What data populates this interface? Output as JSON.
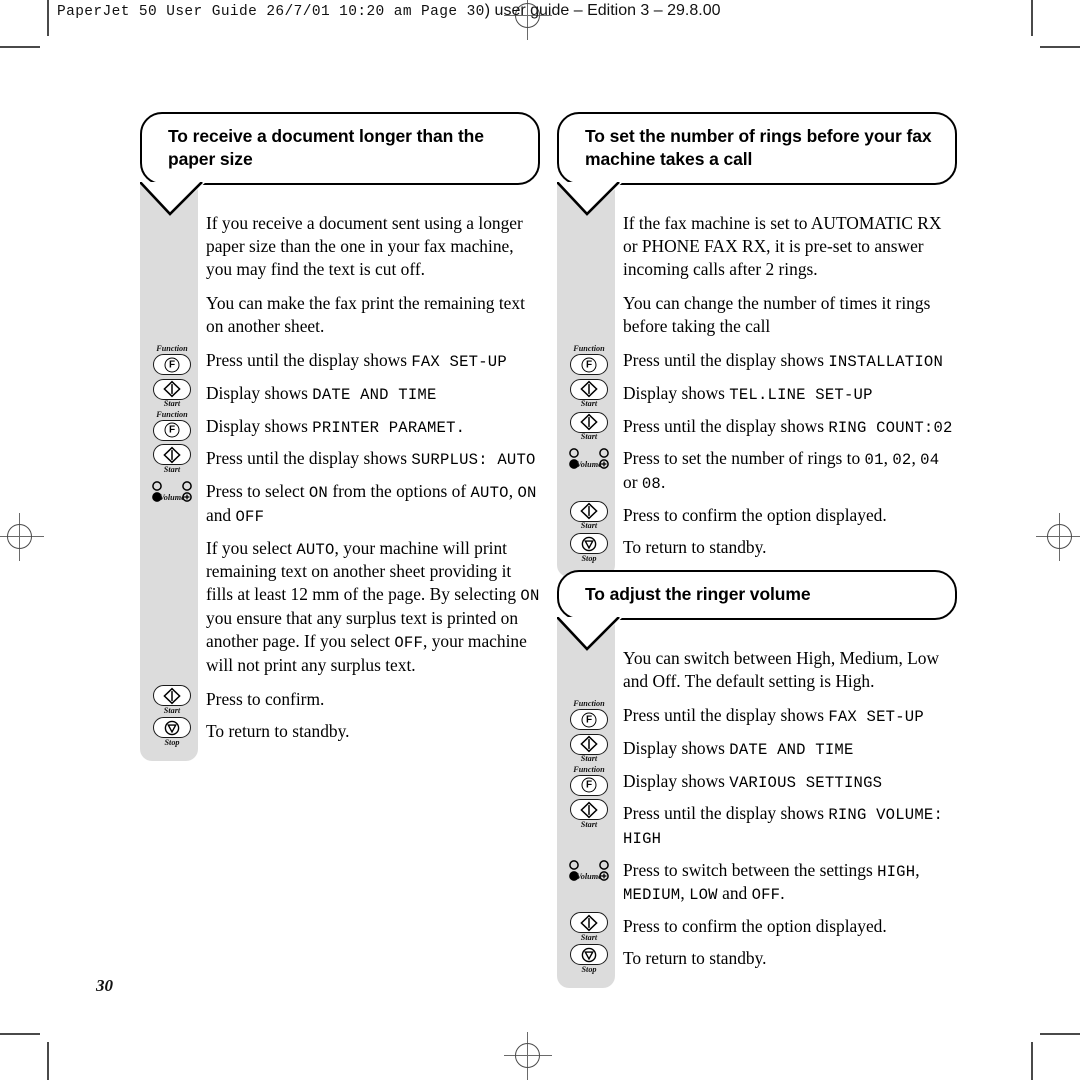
{
  "page": {
    "running_head_mono": "PaperJet 50 User Guide  26/7/01  10:20 am  Page 30",
    "running_head_sans": ") user guide – Edition 3 – 29.8.00",
    "folio": "30"
  },
  "controls": {
    "function": {
      "caption": "Function",
      "key": "F"
    },
    "start": {
      "caption": "Start"
    },
    "stop": {
      "caption": "Stop"
    },
    "volume": {
      "caption": "Volume"
    }
  },
  "sections": [
    {
      "id": "receive-longer-document",
      "heading": "To receive a document longer than the paper size",
      "rows": [
        {
          "control": "none",
          "html": "If you receive a document sent using a longer paper size than the one in your fax machine, you may find the text is cut off."
        },
        {
          "control": "none",
          "html": "You can make the fax print the remaining text on another sheet."
        },
        {
          "control": "function",
          "html": "Press until the display shows <code>FAX SET-UP</code>"
        },
        {
          "control": "start",
          "html": "Display shows <code>DATE AND TIME</code>"
        },
        {
          "control": "function",
          "html": "Display shows <code>PRINTER PARAMET.</code>"
        },
        {
          "control": "start",
          "html": "Press until the display shows <code>SURPLUS: AUTO</code>"
        },
        {
          "control": "volume",
          "html": "Press to select <code>ON</code> from the options of <code>AUTO</code>, <code>ON</code> and <code>OFF</code>"
        },
        {
          "control": "none",
          "html": "If you select <code>AUTO</code>, your machine will print remaining text on another sheet providing it fills at least 12 mm of the page. By selecting <code>ON</code> you ensure that any surplus text is printed on another page. If you select <code>OFF</code>, your machine will not print any surplus text."
        },
        {
          "control": "start",
          "html": "Press to confirm."
        },
        {
          "control": "stop",
          "html": "To return to standby."
        }
      ]
    },
    {
      "id": "number-of-rings",
      "heading": "To set the number of rings before your fax machine takes a call",
      "rows": [
        {
          "control": "none",
          "html": "If the fax machine is set to AUTOMATIC RX or PHONE FAX RX, it is pre-set to answer incoming calls after 2 rings."
        },
        {
          "control": "none",
          "html": "You can change the number of times it rings before taking the call"
        },
        {
          "control": "function",
          "html": "Press until the display shows <code>INSTALLATION</code>"
        },
        {
          "control": "start",
          "html": "Display shows <code>TEL.LINE SET-UP</code>"
        },
        {
          "control": "start",
          "html": "Press until the display shows <code>RING COUNT:02</code>"
        },
        {
          "control": "volume",
          "html": "Press to set the number of rings to <code>01</code>, <code>02</code>, <code>04</code> or <code>08</code>."
        },
        {
          "control": "start",
          "html": "Press to confirm the option displayed."
        },
        {
          "control": "stop",
          "html": "To return to standby."
        }
      ]
    },
    {
      "id": "ringer-volume",
      "heading": "To adjust the ringer volume",
      "rows": [
        {
          "control": "none",
          "html": "You can switch between High, Medium, Low and Off. The default setting is High."
        },
        {
          "control": "function",
          "html": "Press until the display shows <code>FAX SET-UP</code>"
        },
        {
          "control": "start",
          "html": "Display shows <code>DATE AND TIME</code>"
        },
        {
          "control": "function",
          "html": "Display shows <code>VARIOUS SETTINGS</code>"
        },
        {
          "control": "start",
          "html": "Press until the display shows <code>RING VOLUME: HIGH</code>"
        },
        {
          "control": "volume",
          "html": "Press to switch between the settings <code>HIGH</code>, <code>MEDIUM</code>, <code>LOW</code> and <code>OFF</code>."
        },
        {
          "control": "start",
          "html": "Press to confirm the option displayed."
        },
        {
          "control": "stop",
          "html": "To return to standby."
        }
      ]
    }
  ],
  "colors": {
    "rail": "#dcdcdc",
    "ink": "#000000",
    "crop_mark": "#4a4a4a"
  }
}
